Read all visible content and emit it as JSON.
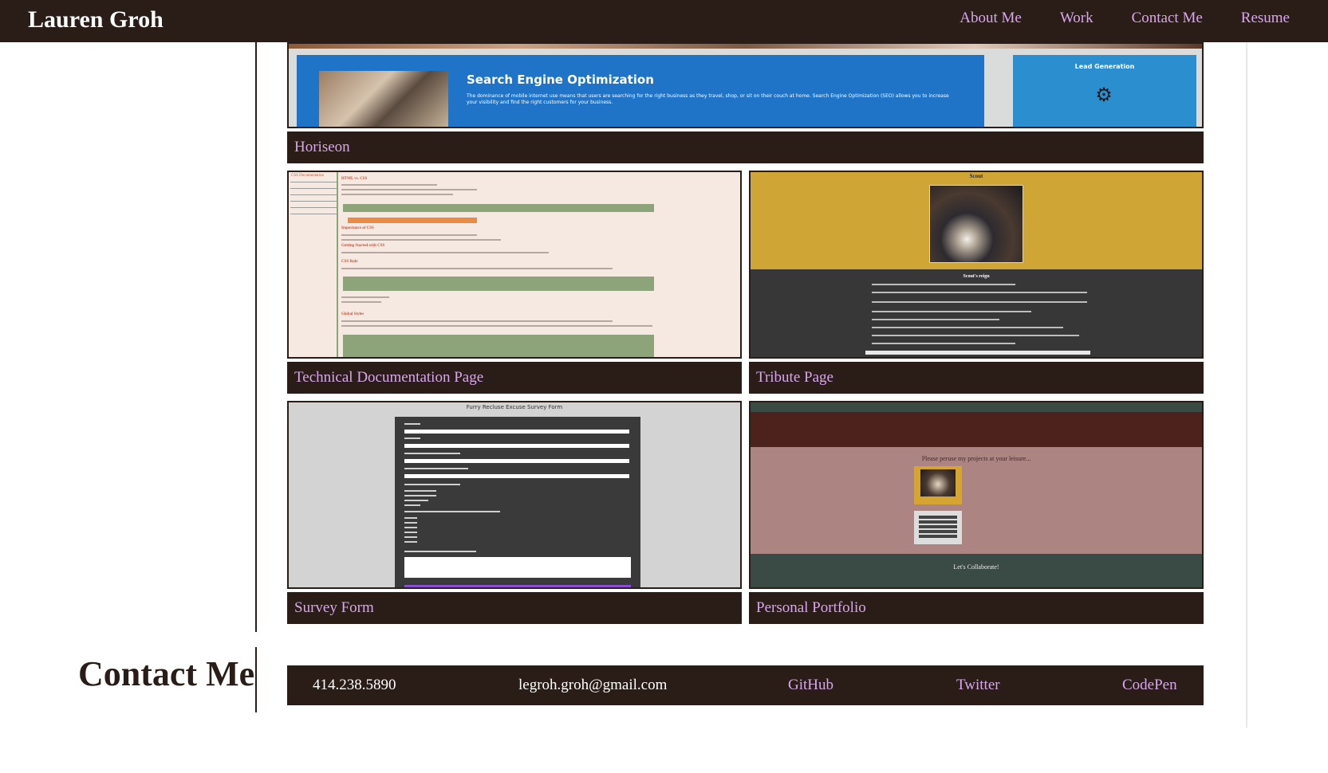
{
  "header": {
    "brand": "Lauren Groh",
    "nav": [
      "About Me",
      "Work",
      "Contact Me",
      "Resume"
    ]
  },
  "projects": [
    {
      "title": "Horiseon",
      "thumb": {
        "headline": "Search Engine Optimization",
        "body": "The dominance of mobile internet use means that users are searching for the right business as they travel, shop, or sit on their couch at home. Search Engine Optimization (SEO) allows you to increase your visibility and find the right customers for your business.",
        "side_title": "Lead Generation"
      }
    },
    {
      "title": "Technical Documentation Page",
      "thumb": {
        "sidebar_title": "CSS Documentation",
        "heading1": "HTML vs. CSS",
        "heading2": "Importance of CSS",
        "heading3": "Getting Started with CSS",
        "heading4": "CSS Rule",
        "heading5": "Global Styles"
      }
    },
    {
      "title": "Tribute Page",
      "thumb": {
        "headline": "Scout",
        "section": "Scout's reign"
      }
    },
    {
      "title": "Survey Form",
      "thumb": {
        "headline": "Furry Recluse Excuse Survey Form"
      }
    },
    {
      "title": "Personal Portfolio",
      "thumb": {
        "headline": "Please peruse my projects at your leisure...",
        "footer": "Let's Collaborate!"
      }
    }
  ],
  "contact": {
    "heading": "Contact Me",
    "phone": "414.238.5890",
    "email": "legroh.groh@gmail.com",
    "links": [
      "GitHub",
      "Twitter",
      "CodePen"
    ]
  },
  "colors": {
    "dark_brown": "#2a1d17",
    "link_lilac": "#d8a6ec"
  }
}
